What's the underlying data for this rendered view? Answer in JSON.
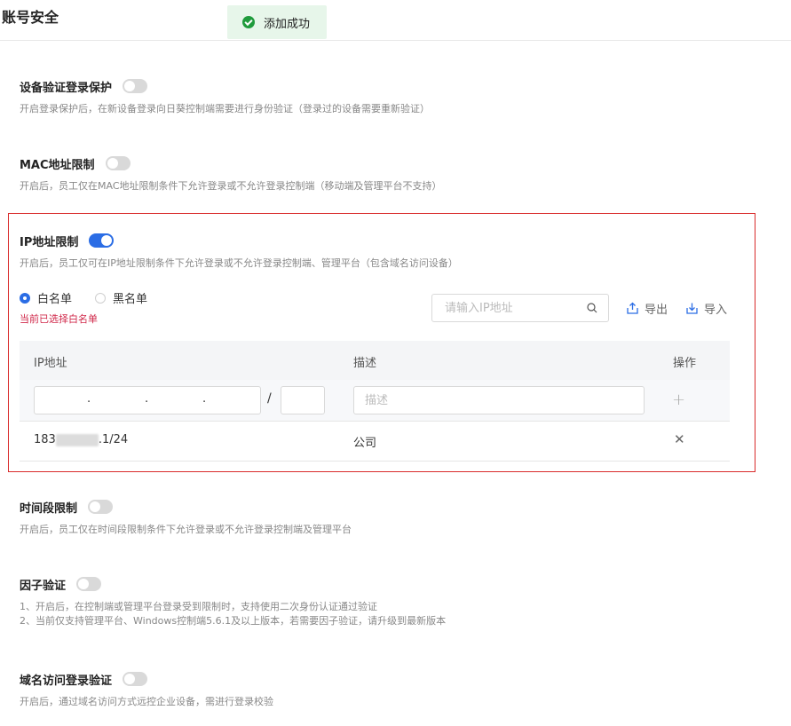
{
  "page_title": "账号安全",
  "toast": {
    "text": "添加成功",
    "icon": "check-circle-icon",
    "color": "#1f9b3c"
  },
  "sections": {
    "device": {
      "title": "设备验证登录保护",
      "enabled": false,
      "desc": "开启登录保护后，在新设备登录向日葵控制端需要进行身份验证（登录过的设备需要重新验证）"
    },
    "mac": {
      "title": "MAC地址限制",
      "enabled": false,
      "desc": "开启后，员工仅在MAC地址限制条件下允许登录或不允许登录控制端（移动端及管理平台不支持）"
    },
    "ip": {
      "title": "IP地址限制",
      "enabled": true,
      "desc": "开启后，员工仅可在IP地址限制条件下允许登录或不允许登录控制端、管理平台（包含域名访问设备）",
      "radio_whitelist": "白名单",
      "radio_blacklist": "黑名单",
      "selected": "白名单",
      "hint": "当前已选择白名单",
      "search_placeholder": "请输入IP地址",
      "export_label": "导出",
      "import_label": "导入",
      "columns": {
        "ip": "IP地址",
        "desc": "描述",
        "ops": "操作"
      },
      "desc_placeholder": "描述",
      "rows": [
        {
          "ip_prefix": "183",
          "ip_suffix": ".1/24",
          "desc": "公司"
        }
      ]
    },
    "time": {
      "title": "时间段限制",
      "enabled": false,
      "desc": "开启后，员工仅在时间段限制条件下允许登录或不允许登录控制端及管理平台"
    },
    "factor": {
      "title": "因子验证",
      "enabled": false,
      "desc1": "1、开启后，在控制端或管理平台登录受到限制时，支持使用二次身份认证通过验证",
      "desc2": "2、当前仅支持管理平台、Windows控制端5.6.1及以上版本，若需要因子验证，请升级到最新版本"
    },
    "domain": {
      "title": "域名访问登录验证",
      "enabled": false,
      "desc": "开启后，通过域名访问方式远控企业设备，需进行登录校验"
    }
  },
  "colors": {
    "accent": "#2b6de5",
    "highlight_border": "#d92b2b",
    "hint_red": "#d0284a"
  }
}
